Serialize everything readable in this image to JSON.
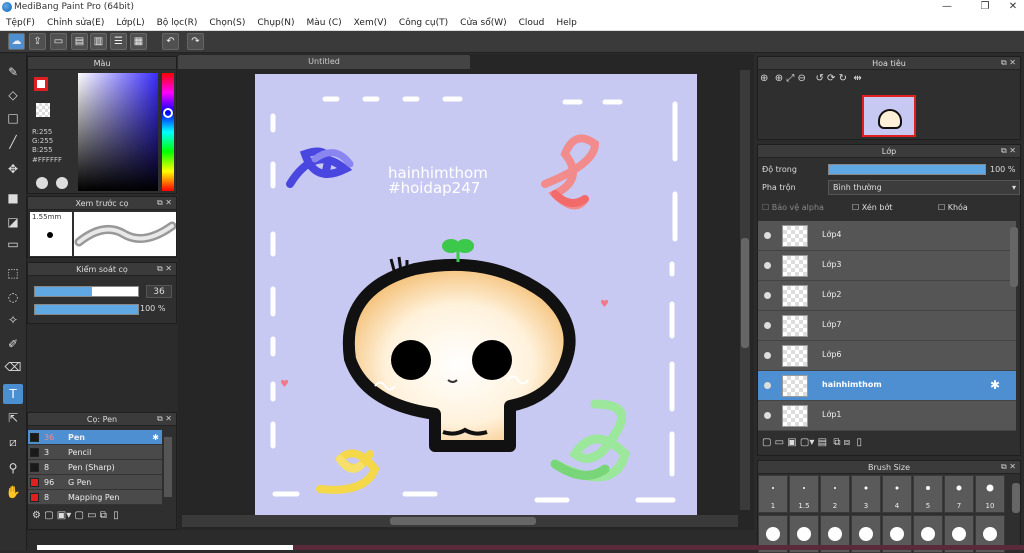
{
  "window": {
    "title": "MediBang Paint Pro (64bit)"
  },
  "menu": [
    "Tệp(F)",
    "Chỉnh sửa(E)",
    "Lớp(L)",
    "Bộ lọc(R)",
    "Chọn(S)",
    "Chụp(N)",
    "Màu (C)",
    "Xem(V)",
    "Công cụ(T)",
    "Cửa sổ(W)",
    "Cloud",
    "Help"
  ],
  "toolbar_icons": [
    "cloud-icon",
    "export-icon",
    "comment-icon",
    "document-icon",
    "page-icon",
    "list-icon",
    "grid-icon",
    "undo-icon",
    "redo-icon"
  ],
  "color_panel": {
    "title": "Màu",
    "r": "R:255",
    "g": "G:255",
    "b": "B:255",
    "hex": "#FFFFFF",
    "primary": "#e02020",
    "secondary": "#ffffff"
  },
  "brush_preview": {
    "title": "Xem trước cọ",
    "size": "1.55mm"
  },
  "brush_control": {
    "title": "Kiểm soát cọ",
    "size_value": "36",
    "opacity_value": "100 %",
    "size_fill": 0.55,
    "opacity_fill": 1.0
  },
  "brush_list": {
    "title": "Cọ: Pen",
    "items": [
      {
        "size": "36",
        "name": "Pen",
        "color": "#1a1a1a",
        "selected": true
      },
      {
        "size": "3",
        "name": "Pencil",
        "color": "#1a1a1a",
        "selected": false
      },
      {
        "size": "8",
        "name": "Pen (Sharp)",
        "color": "#1a1a1a",
        "selected": false
      },
      {
        "size": "96",
        "name": "G Pen",
        "color": "#e02020",
        "selected": false
      },
      {
        "size": "8",
        "name": "Mapping Pen",
        "color": "#e02020",
        "selected": false
      }
    ]
  },
  "canvas": {
    "tab": "Untitled",
    "overlay_text_1": "hainhimthom",
    "overlay_text_2": "#hoidap247"
  },
  "navigator": {
    "title": "Hoa tiêu"
  },
  "layer_panel": {
    "title": "Lớp",
    "opacity_label": "Độ trong",
    "opacity_value": "100 %",
    "opacity_fill": 1.0,
    "blend_label": "Pha trộn",
    "blend_value": "Bình thường",
    "protect_alpha": "Bảo vệ alpha",
    "clipping": "Xén bớt",
    "lock": "Khóa",
    "layers": [
      {
        "name": "Lớp4",
        "selected": false
      },
      {
        "name": "Lớp3",
        "selected": false
      },
      {
        "name": "Lớp2",
        "selected": false
      },
      {
        "name": "Lớp7",
        "selected": false
      },
      {
        "name": "Lớp6",
        "selected": false
      },
      {
        "name": "hainhimthom",
        "selected": true
      },
      {
        "name": "Lớp1",
        "selected": false
      }
    ]
  },
  "brush_size": {
    "title": "Brush Size",
    "sizes": [
      "1",
      "1.5",
      "2",
      "3",
      "4",
      "5",
      "7",
      "10"
    ]
  }
}
